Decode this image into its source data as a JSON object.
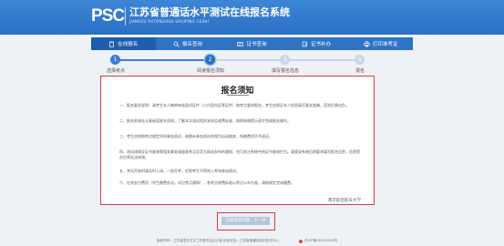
{
  "header": {
    "logo": "PSC",
    "title": "江苏省普通话水平测试在线报名系统",
    "subtitle": "JIANGSU PUTONGHUA SHUIPING CESHI"
  },
  "nav": {
    "items": [
      {
        "label": "在线报名",
        "icon": "clipboard-icon"
      },
      {
        "label": "报名查询",
        "icon": "search-icon"
      },
      {
        "label": "证书查询",
        "icon": "certificate-icon"
      },
      {
        "label": "证书补办",
        "icon": "edit-document-icon"
      },
      {
        "label": "打印准考证",
        "icon": "printer-icon"
      }
    ]
  },
  "steps": [
    {
      "num": "1",
      "label": "选择考点"
    },
    {
      "num": "2",
      "label": "阅读报名须知"
    },
    {
      "num": "3",
      "label": "填写报名信息"
    },
    {
      "num": "4",
      "label": "报名"
    }
  ],
  "notice": {
    "title": "报名须知",
    "paragraphs": [
      "一、报名要求说明：请考生本人携带有效身份证件（二代身份证等证件）按考点要求报名，考生应保证本人信息填写真实准确，否则后果自负。",
      "二、报名前请先认真阅读报名须知，了解本次测试相关安排及收费标准，按照系统提示逐步完成报名操作。",
      "三、考生应按照考点规定时间参加测试，逾期未参加测试的视为自动放弃，所缴费用不予退还。",
      "四、测试成绩及证书查询等相关事宜请留意考点及官方网站发布的通知，也可关注系统中的证书查询栏目。请登录系统后按要求填写报名信息，信息提交后将无法修改。",
      "五、考试开始时请及时入场，一经开考，迟到考生不得进入考场参加测试。",
      "六、在线支付费用（学生缴费办法，详见考点通知），各考点收费标准以考点公布为准，请按规定完成缴费。"
    ],
    "signature": "南京航空航天大学"
  },
  "next_button": "已阅读并同意，下一步",
  "footer": {
    "left": "版权所有：江苏省语言文字工作委员会办公室   技术支持：江苏省普通话培训测试中心",
    "right": "苏ICP备XXXXXXXX号"
  },
  "colors": {
    "header": "#2a6fc4",
    "nav": "#2f73c5",
    "step_active": "#3a7fd0",
    "highlight_border": "#e0393e"
  }
}
